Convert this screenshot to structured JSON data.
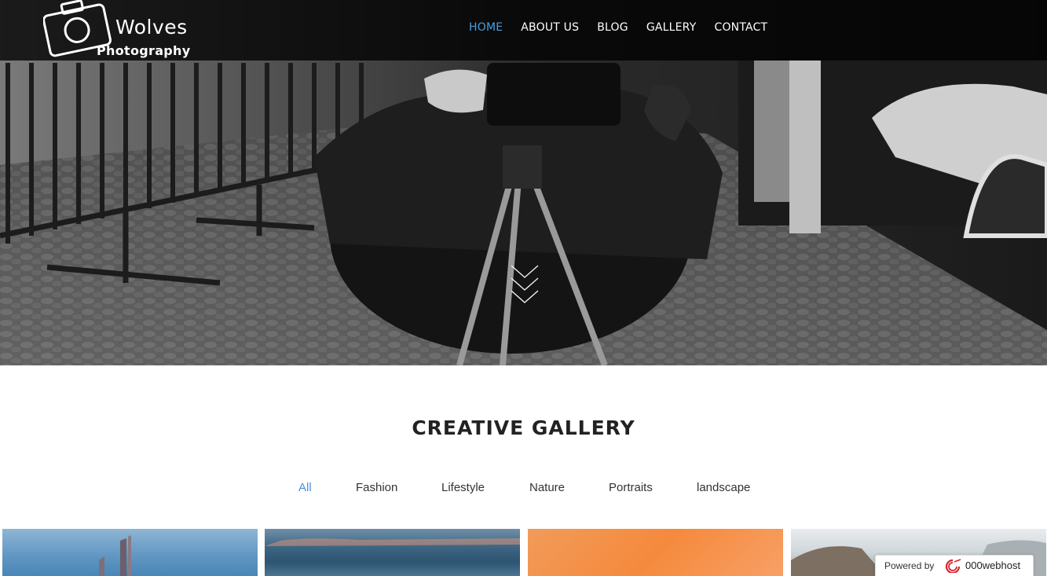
{
  "header": {
    "logo": {
      "line1": "Wolves",
      "line2": "Photography",
      "icon": "camera-icon"
    },
    "nav": [
      {
        "label": "HOME",
        "active": true
      },
      {
        "label": "ABOUT US",
        "active": false
      },
      {
        "label": "BLOG",
        "active": false
      },
      {
        "label": "GALLERY",
        "active": false
      },
      {
        "label": "CONTACT",
        "active": false
      }
    ]
  },
  "hero": {
    "scroll_icon": "triple-chevron-down-icon"
  },
  "gallery": {
    "title": "CREATIVE GALLERY",
    "filters": [
      "All",
      "Fashion",
      "Lifestyle",
      "Nature",
      "Portraits",
      "landscape"
    ],
    "active_filter": "All"
  },
  "badge": {
    "label": "Powered by",
    "brand": "000webhost"
  },
  "colors": {
    "accent": "#4a9fe0",
    "filter_active": "#4a90d9"
  }
}
